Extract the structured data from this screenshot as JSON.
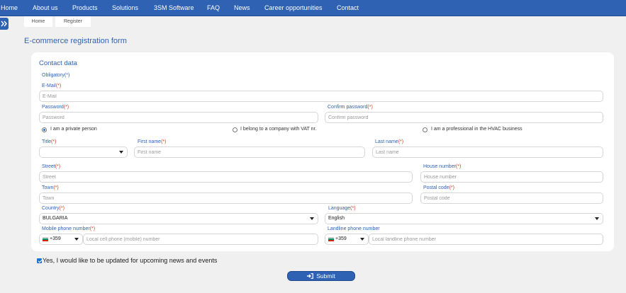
{
  "nav": {
    "items": [
      "Home",
      "About us",
      "Products",
      "Solutions",
      "3SM Software",
      "FAQ",
      "News",
      "Career opportunities",
      "Contact"
    ]
  },
  "breadcrumb": [
    "Home",
    "Register"
  ],
  "page_title": "E-commerce registration form",
  "section_title": "Contact data",
  "obligatory_note": "Obligatory(*)",
  "required_mark": "(*)",
  "fields": {
    "email": {
      "label": "E-Mail",
      "placeholder": "E-Mail"
    },
    "password": {
      "label": "Password",
      "placeholder": "Password"
    },
    "confirm_password": {
      "label": "Confirm password",
      "placeholder": "Confirm password"
    },
    "title": {
      "label": "Title",
      "value": ""
    },
    "first_name": {
      "label": "First name",
      "placeholder": "First name"
    },
    "last_name": {
      "label": "Last name",
      "placeholder": "Last name"
    },
    "street": {
      "label": "Street",
      "placeholder": "Street"
    },
    "house_number": {
      "label": "House number",
      "placeholder": "House number"
    },
    "town": {
      "label": "Town",
      "placeholder": "Town"
    },
    "postal_code": {
      "label": "Postal code",
      "placeholder": "Postal code"
    },
    "country": {
      "label": "Country",
      "value": "BULGARIA"
    },
    "language": {
      "label": "Language",
      "value": "English"
    },
    "mobile": {
      "label": "Mobile phone number",
      "prefix": "+359",
      "placeholder": "Local cell phone (mobile) number"
    },
    "landline": {
      "label": "Landline phone number",
      "prefix": "+359",
      "placeholder": "Local landline phone number"
    }
  },
  "customer_type": {
    "options": [
      "I am a private person",
      "I belong to a company with VAT nr.",
      "I am a professional in the HVAC business"
    ],
    "selected": 0
  },
  "newsletter": {
    "label": "Yes, I would like to be updated for upcoming news and events",
    "checked": true
  },
  "submit_label": "Submit",
  "colors": {
    "brand": "#2f62b3",
    "background": "#f0f0f0",
    "required": "#cc4422"
  },
  "icons": {
    "sidebar_toggle": "double-chevron-right-icon",
    "submit": "sign-in-icon",
    "phone_flag": "bulgaria-flag-icon"
  }
}
